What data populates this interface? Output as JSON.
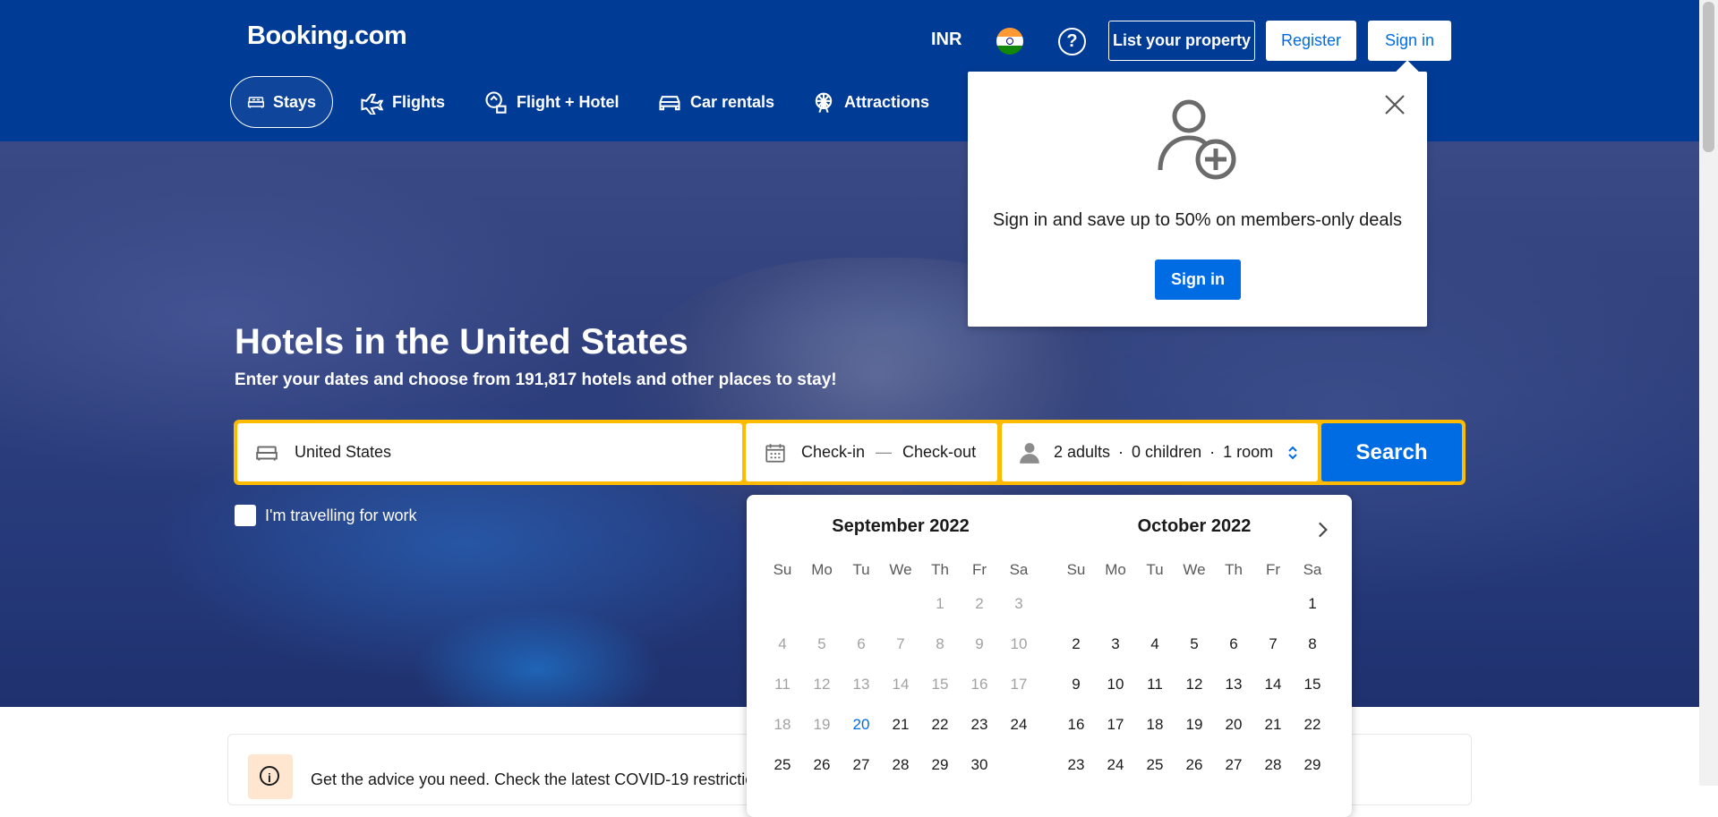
{
  "header": {
    "logo": "Booking.com",
    "currency": "INR",
    "list_property": "List your property",
    "register": "Register",
    "sign_in": "Sign in"
  },
  "nav": {
    "stays": "Stays",
    "flights": "Flights",
    "flight_hotel": "Flight + Hotel",
    "car_rentals": "Car rentals",
    "attractions": "Attractions"
  },
  "hero": {
    "title": "Hotels in the United States",
    "subtitle": "Enter your dates and choose from 191,817 hotels and other places to stay!"
  },
  "search": {
    "destination": "United States",
    "check_in": "Check-in",
    "dash": "—",
    "check_out": "Check-out",
    "adults": "2 adults",
    "dot1": "·",
    "children": "0 children",
    "dot2": "·",
    "rooms": "1 room",
    "button": "Search"
  },
  "work": {
    "label": "I'm travelling for work"
  },
  "covid": {
    "icon_text": "i",
    "text": "Get the advice you need. Check the latest COVID-19 restrictions"
  },
  "popup": {
    "message": "Sign in and save up to 50% on members-only deals",
    "button": "Sign in"
  },
  "calendar": {
    "weekdays": [
      "Su",
      "Mo",
      "Tu",
      "We",
      "Th",
      "Fr",
      "Sa"
    ],
    "months": [
      {
        "title": "September 2022",
        "leading_blanks": 4,
        "days": [
          1,
          2,
          3,
          4,
          5,
          6,
          7,
          8,
          9,
          10,
          11,
          12,
          13,
          14,
          15,
          16,
          17,
          18,
          19,
          20,
          21,
          22,
          23,
          24,
          25,
          26,
          27,
          28,
          29,
          30
        ],
        "today": 20
      },
      {
        "title": "October 2022",
        "leading_blanks": 6,
        "days": [
          1,
          2,
          3,
          4,
          5,
          6,
          7,
          8,
          9,
          10,
          11,
          12,
          13,
          14,
          15,
          16,
          17,
          18,
          19,
          20,
          21,
          22,
          23,
          24,
          25,
          26,
          27,
          28,
          29
        ],
        "today": null
      }
    ]
  }
}
